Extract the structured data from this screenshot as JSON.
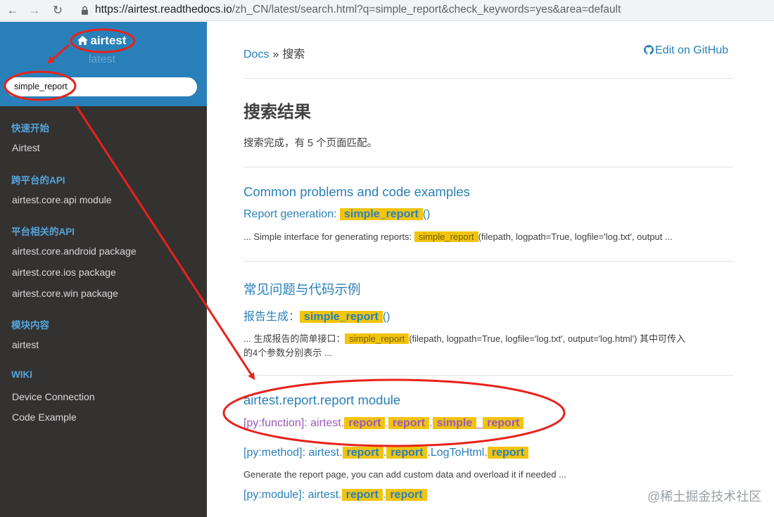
{
  "browser": {
    "back_icon": "←",
    "forward_icon": "→",
    "reload_icon": "↻",
    "url_host": "https://airtest.readthedocs.io",
    "url_path": "/zh_CN/latest/search.html?q=simple_report&check_keywords=yes&area=default"
  },
  "sidebar": {
    "brand": "airtest",
    "version": "latest",
    "search_value": "simple_report",
    "captions": [
      "快速开始",
      "跨平台的API",
      "平台相关的API",
      "模块内容",
      "WIKI"
    ],
    "items": [
      "Airtest",
      "airtest.core.api module",
      "airtest.core.android package",
      "airtest.core.ios package",
      "airtest.core.win package",
      "airtest",
      "Device Connection",
      "Code Example"
    ]
  },
  "header": {
    "breadcrumb_root": "Docs",
    "breadcrumb_sep": "»",
    "breadcrumb_current": "搜索",
    "edit_link": "Edit on GitHub"
  },
  "page": {
    "title": "搜索结果",
    "summary": "搜索完成，有 5 个页面匹配。"
  },
  "results": {
    "r1": {
      "title": "Common problems and code examples",
      "link_prefix": "Report generation: ",
      "link_hl": "simple_report",
      "link_suffix": "()",
      "ctx_prefix": "... Simple interface for generating reports: ",
      "ctx_hl": "simple_report",
      "ctx_suffix": "(filepath, logpath=True, logfile='log.txt', output ..."
    },
    "r2": {
      "title": "常见问题与代码示例",
      "link_prefix": "报告生成：",
      "link_hl": "simple_report",
      "link_suffix": "()",
      "ctx_prefix": "... 生成报告的简单接口：",
      "ctx_hl": "simple_report",
      "ctx_suffix": "(filepath, logpath=True, logfile='log.txt', output='log.html') 其中可传入",
      "ctx_line2": "的4个参数分别表示 ..."
    },
    "r3": {
      "title": "airtest.report.report module",
      "fn_prefix": "[py:function]: airtest.",
      "fn_hl1": "report",
      "fn_dot1": ".",
      "fn_hl2": "report",
      "fn_dot2": ".",
      "fn_hl3": "simple",
      "fn_us": "_",
      "fn_hl4": "report",
      "method_prefix": "[py:method]: airtest.",
      "method_hl1": "report",
      "method_dot1": ".",
      "method_hl2": "report",
      "method_mid": ".LogToHtml.",
      "method_hl3": "report",
      "method_ctx": "Generate the report page, you can add custom data and overload it if needed ...",
      "module_prefix": "[py:module]: airtest.",
      "module_hl1": "report",
      "module_dot": ".",
      "module_hl2": "report"
    }
  },
  "watermark": "@稀土掘金技术社区",
  "colors": {
    "sidebar_top": "#2980b9",
    "sidebar_bg": "#343131",
    "link": "#2980b9",
    "highlight": "#f1c40f",
    "annotation": "#e8221b"
  },
  "icons": [
    "home-icon",
    "github-icon",
    "lock-icon",
    "back-icon",
    "forward-icon",
    "reload-icon"
  ]
}
